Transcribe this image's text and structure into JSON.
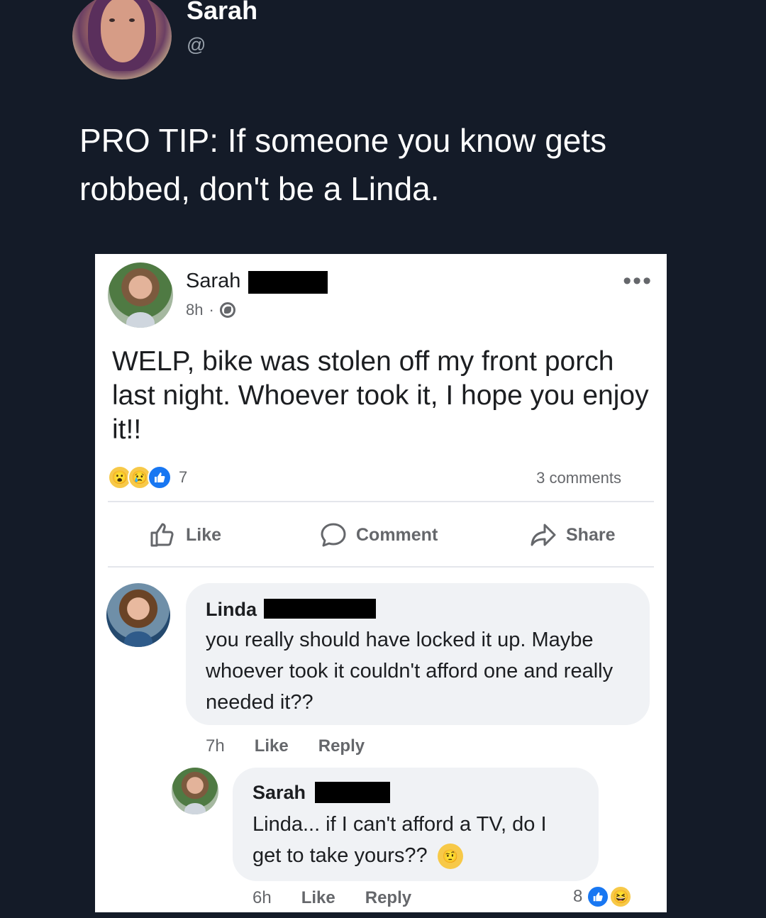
{
  "tweet": {
    "author_name": "Sarah",
    "handle": "@",
    "text": "PRO TIP: If someone you know gets robbed, don't be a Linda."
  },
  "post": {
    "author_name": "Sarah",
    "time": "8h",
    "meta_separator": "·",
    "more_icon": "ellipsis-icon",
    "text": "WELP, bike was stolen off my front porch last night. Whoever took it, I hope you enjoy it!!",
    "reactions": [
      "wow",
      "sad",
      "like"
    ],
    "reaction_count": "7",
    "comments_count": "3 comments",
    "actions": {
      "like": "Like",
      "comment": "Comment",
      "share": "Share"
    }
  },
  "comments": [
    {
      "author_name": "Linda",
      "text": "you really should have locked it up. Maybe whoever took it couldn't afford one and really needed it??",
      "time": "7h",
      "like_label": "Like",
      "reply_label": "Reply"
    },
    {
      "author_name": "Sarah",
      "text": "Linda... if I can't afford a TV, do I get to take yours??",
      "emoji": "thinking-face",
      "time": "6h",
      "like_label": "Like",
      "reply_label": "Reply",
      "reaction_count": "8",
      "reactions": [
        "like",
        "haha"
      ]
    }
  ],
  "colors": {
    "background": "#141b28",
    "fb_blue": "#1877f2",
    "gray_text": "#65676b",
    "bubble": "#f0f2f5"
  }
}
